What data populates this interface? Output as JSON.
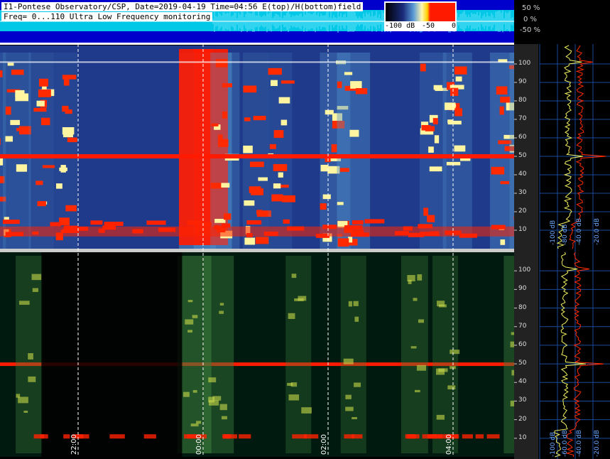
{
  "header": {
    "line1": "I1-Pontese Observatory/CSP, Date=2019-04-19 Time=04:56 E(top)/H(bottom)field",
    "line2": "Freq= 0...110 Ultra Low Frequency monitoring"
  },
  "colorbar": {
    "labels": [
      "-100 dB",
      "-50",
      "0"
    ]
  },
  "chart_data": {
    "type": "heatmap",
    "title": "",
    "panels": [
      {
        "name": "E(top)",
        "colormap": "blue-yellow-red"
      },
      {
        "name": "H(bottom)",
        "colormap": "green-yellow-red"
      }
    ],
    "y_axis": {
      "ticks": [
        10,
        20,
        30,
        40,
        50,
        60,
        70,
        80,
        90,
        100
      ],
      "range": [
        0,
        110
      ]
    },
    "time_axis": {
      "ticks": [
        "22:00",
        "00:00",
        "02:00",
        "04:00"
      ]
    },
    "amplitude_axis": {
      "ticks": [
        "-40 dB",
        "-20 dB",
        "-40.0 dB",
        "-20.0 dB"
      ],
      "alt_ticks": [
        "-100 dB",
        "-80 dB",
        "-60.0 dB"
      ]
    },
    "percent_axis": {
      "ticks": [
        "50 %",
        "0 %",
        "-50 %"
      ]
    },
    "persistent_lines_hz": [
      50,
      101,
      39
    ],
    "top_gaps": [
      "23:50-00:15"
    ]
  },
  "colors": {
    "top_bg": "#1f3a8a",
    "bottom_bg": "#001a10",
    "strip": "#00c8e6",
    "line": "#ff1a00"
  }
}
